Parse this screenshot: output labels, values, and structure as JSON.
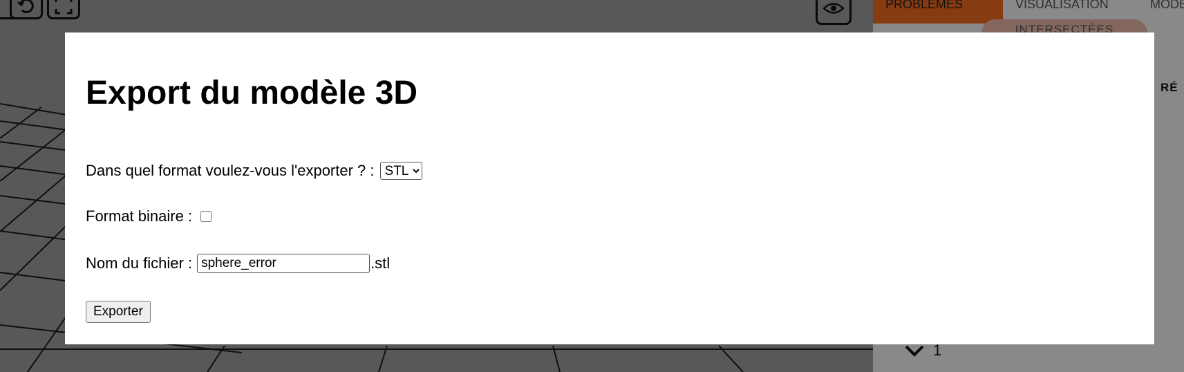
{
  "background": {
    "panel_tabs": [
      "PROBLÈMES",
      "VISUALISATION",
      "MODÈLE"
    ],
    "panel_pill": "INTERSECTÉES",
    "panel_heading": "RÉ",
    "collapse_count": "1",
    "accent_color": "#f06a1e"
  },
  "modal": {
    "title": "Export du modèle 3D",
    "format_label": "Dans quel format voulez-vous l'exporter ? :",
    "format_selected": "STL",
    "binary_label": "Format binaire :",
    "binary_checked": false,
    "filename_label": "Nom du fichier :",
    "filename_value": "sphere_error",
    "filename_extension": ".stl",
    "export_button": "Exporter"
  },
  "icons": {
    "viewport_buttons": [
      "refresh-icon",
      "fit-view-icon"
    ],
    "view_toggle": "eye-icon",
    "collapse": "chevron-down-icon"
  }
}
